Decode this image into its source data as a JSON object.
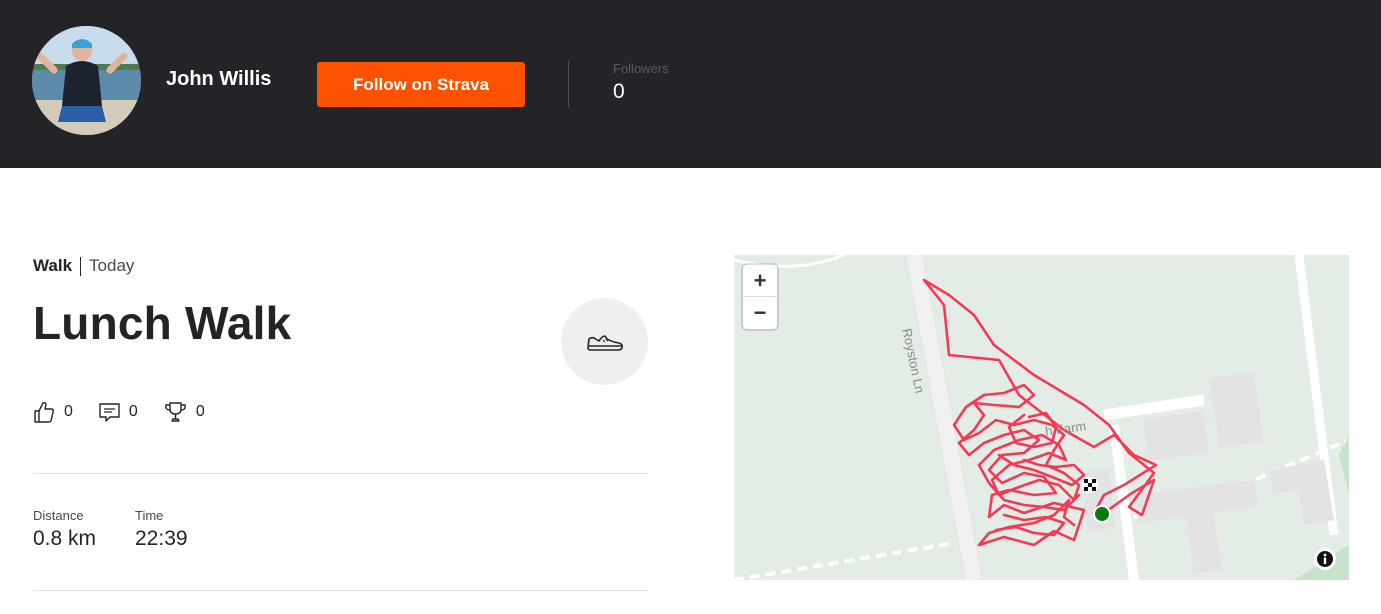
{
  "header": {
    "athlete_name": "John Willis",
    "follow_label": "Follow on Strava",
    "followers_label": "Followers",
    "followers_count": "0"
  },
  "activity": {
    "type": "Walk",
    "date": "Today",
    "title": "Lunch Walk",
    "sport_icon": "shoe-icon",
    "kudos": "0",
    "comments": "0",
    "achievements": "0"
  },
  "stats": {
    "distance_label": "Distance",
    "distance_value": "0.8 km",
    "time_label": "Time",
    "time_value": "22:39"
  },
  "map": {
    "zoom_in": "+",
    "zoom_out": "−",
    "road_label": "Royston Ln",
    "place_label": "h Farm",
    "route_color": "#f23a55",
    "start_color": "#0a7a12",
    "background_color": "#e4ece6"
  },
  "colors": {
    "header_bg": "#242428",
    "accent": "#fc5200"
  }
}
